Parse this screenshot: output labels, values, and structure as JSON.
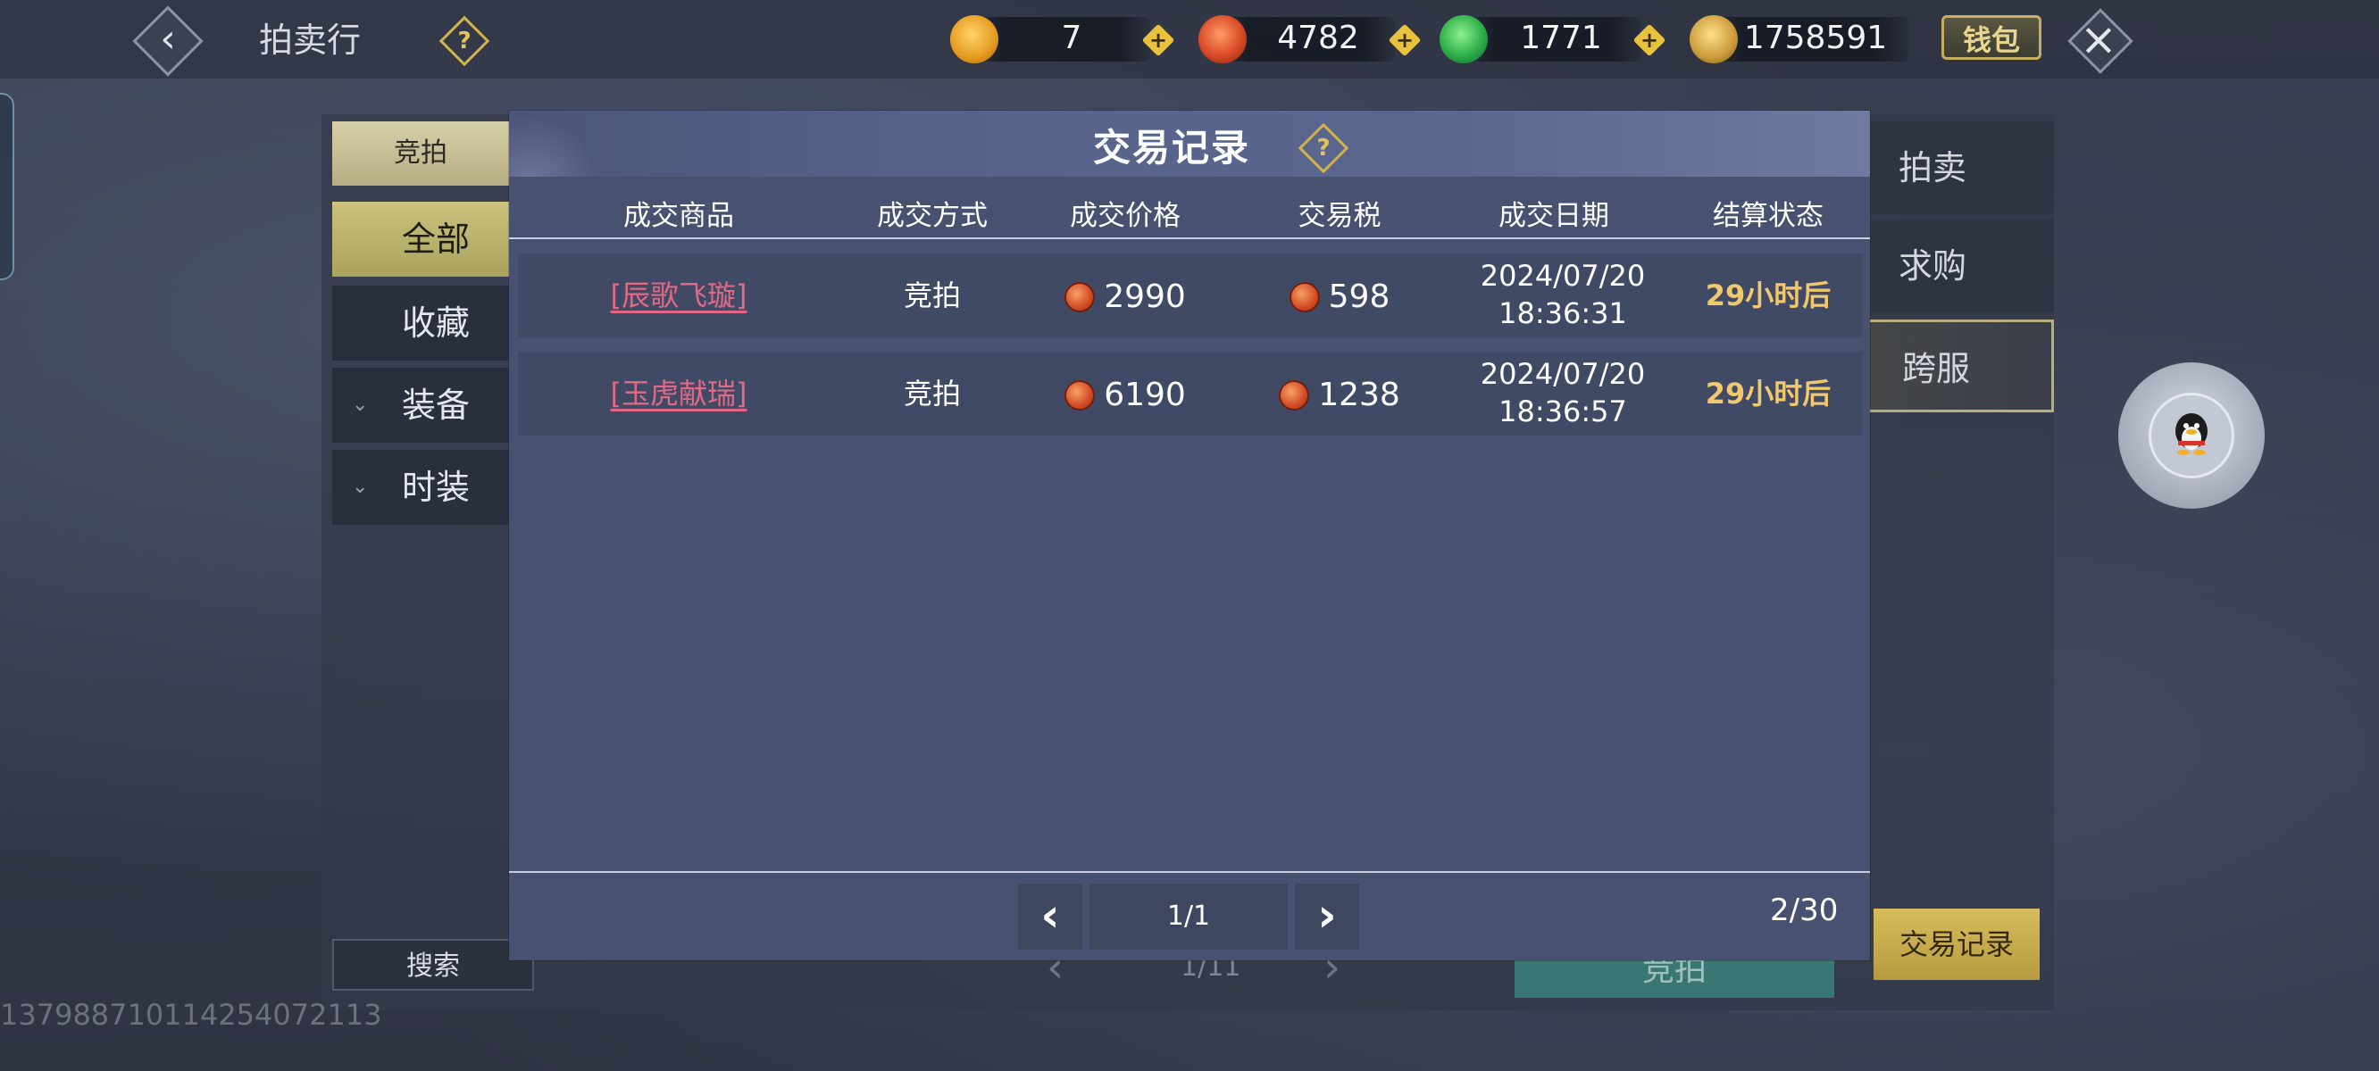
{
  "header": {
    "title": "拍卖行",
    "wallet_label": "钱包",
    "currencies": [
      {
        "icon": "gold-ingot-icon",
        "value": "7",
        "color": "#e8a53a"
      },
      {
        "icon": "red-swirl-coin-icon",
        "value": "4782",
        "color": "#d94a26"
      },
      {
        "icon": "green-jade-icon",
        "value": "1771",
        "color": "#2eae4a"
      },
      {
        "icon": "gold-feather-coin-icon",
        "value": "1758591",
        "color": "#c99a3a"
      }
    ]
  },
  "sidebar": {
    "bid_tab": "竞拍",
    "items": [
      {
        "label": "全部"
      },
      {
        "label": "收藏"
      },
      {
        "label": "装备"
      },
      {
        "label": "时装"
      }
    ],
    "search_label": "搜索"
  },
  "right_tabs": [
    "拍卖",
    "求购",
    "跨服"
  ],
  "trade_record_button": "交易记录",
  "background_pager": "1/11",
  "background_bid_button": "竞拍",
  "watermark": "1379887101142540721​13",
  "modal": {
    "title": "交易记录",
    "columns": [
      "成交商品",
      "成交方式",
      "成交价格",
      "交易税",
      "成交日期",
      "结算状态"
    ],
    "rows": [
      {
        "item": "[辰歌飞璇]",
        "method": "竞拍",
        "price": "2990",
        "tax": "598",
        "date": "2024/07/20",
        "time": "18:36:31",
        "status": "29小时后"
      },
      {
        "item": "[玉虎献瑞]",
        "method": "竞拍",
        "price": "6190",
        "tax": "1238",
        "date": "2024/07/20",
        "time": "18:36:57",
        "status": "29小时后"
      }
    ],
    "page": "1/1",
    "count": "2/30"
  }
}
